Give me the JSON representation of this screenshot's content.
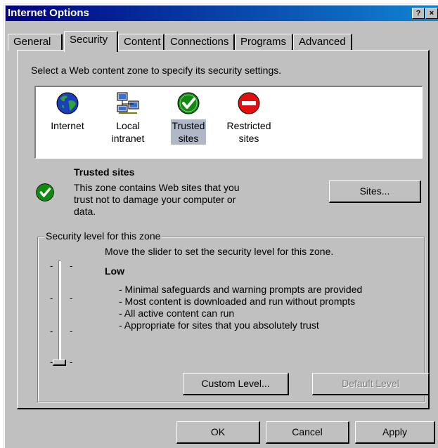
{
  "window": {
    "title": "Internet Options",
    "help_btn": "?",
    "close_btn": "×"
  },
  "tabs": [
    {
      "label": "General"
    },
    {
      "label": "Security"
    },
    {
      "label": "Content"
    },
    {
      "label": "Connections"
    },
    {
      "label": "Programs"
    },
    {
      "label": "Advanced"
    }
  ],
  "active_tab": "Security",
  "security": {
    "instruction": "Select a Web content zone to specify its security settings.",
    "zones": [
      {
        "line1": "Internet",
        "line2": "",
        "icon": "globe-icon"
      },
      {
        "line1": "Local",
        "line2": "intranet",
        "icon": "network-computers-icon"
      },
      {
        "line1": "Trusted",
        "line2": "sites",
        "icon": "green-check-icon"
      },
      {
        "line1": "Restricted",
        "line2": "sites",
        "icon": "red-no-entry-icon"
      }
    ],
    "selected_zone": "Trusted sites",
    "zone_name": "Trusted sites",
    "zone_desc_lines": [
      "This zone contains Web sites that you",
      "trust not to damage your computer or",
      "data."
    ],
    "sites_button": "Sites...",
    "level_group": {
      "label": "Security level for this zone",
      "slider_instruction": "Move the slider to set the security level for this zone.",
      "level_name": "Low",
      "level_value": 0,
      "bullets": [
        "- Minimal safeguards and warning prompts are provided",
        "- Most content is downloaded and run without prompts",
        "- All active content can run",
        "- Appropriate for sites that you absolutely trust"
      ],
      "custom_level_button": "Custom Level...",
      "default_level_button": "Default Level"
    }
  },
  "footer": {
    "ok": "OK",
    "cancel": "Cancel",
    "apply": "Apply"
  },
  "colors": {
    "title_start": "#000080",
    "title_end": "#1084d0",
    "face": "#c0c0c0",
    "selection": "#b0b8c8"
  }
}
